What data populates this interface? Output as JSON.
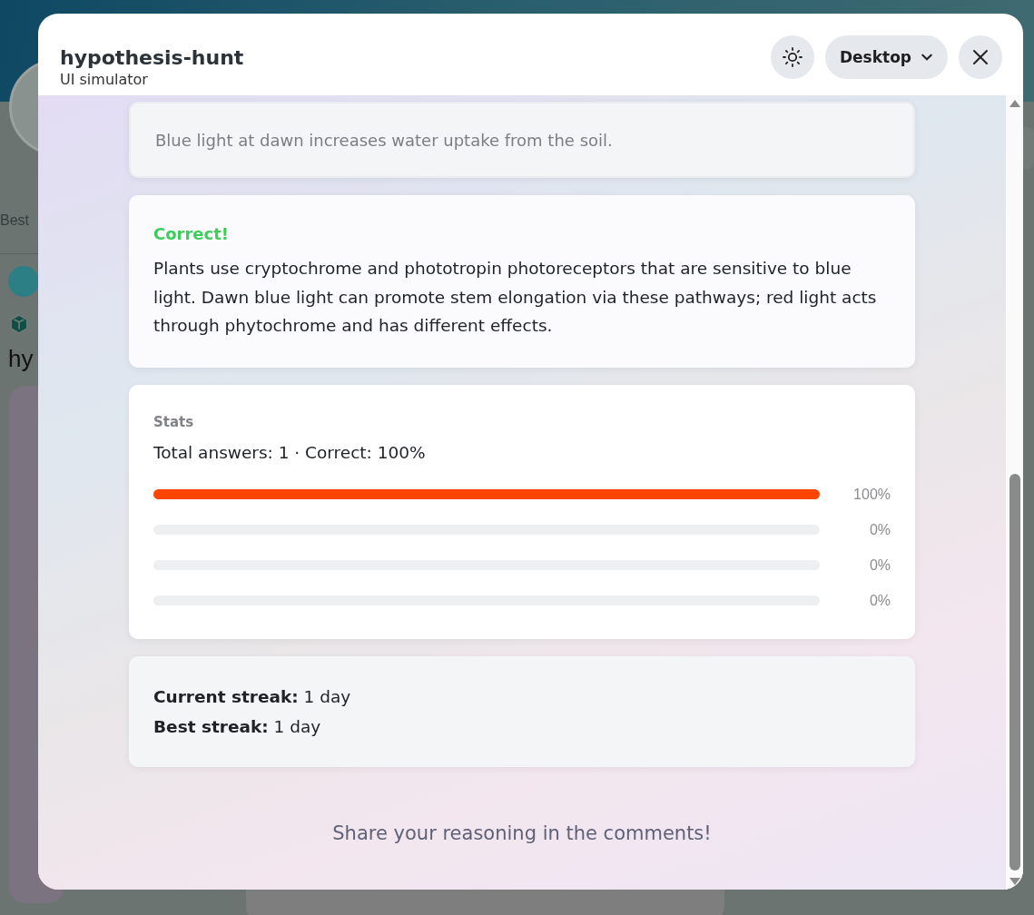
{
  "background_page": {
    "sort_label": "Best",
    "post_title": "hy"
  },
  "window": {
    "title": "hypothesis-hunt",
    "subtitle": "UI simulator",
    "device": "Desktop"
  },
  "answer_option": {
    "text": "Blue light at dawn increases water uptake from the soil."
  },
  "result": {
    "verdict": "Correct!",
    "explanation": "Plants use cryptochrome and phototropin photoreceptors that are sensitive to blue light. Dawn blue light can promote stem elongation via these pathways; red light acts through phytochrome and has different effects."
  },
  "stats": {
    "heading": "Stats",
    "summary": "Total answers: 1 · Correct: 100%",
    "bars": [
      {
        "level": 1,
        "reading": "100%"
      },
      {
        "level": 0,
        "reading": "0%"
      },
      {
        "level": 0,
        "reading": "0%"
      },
      {
        "level": 0,
        "reading": "0%"
      }
    ]
  },
  "streaks": [
    "**Current streak:** 1 day",
    "**Best streak:** 1 day"
  ],
  "footer": "Share your reasoning in the comments!"
}
